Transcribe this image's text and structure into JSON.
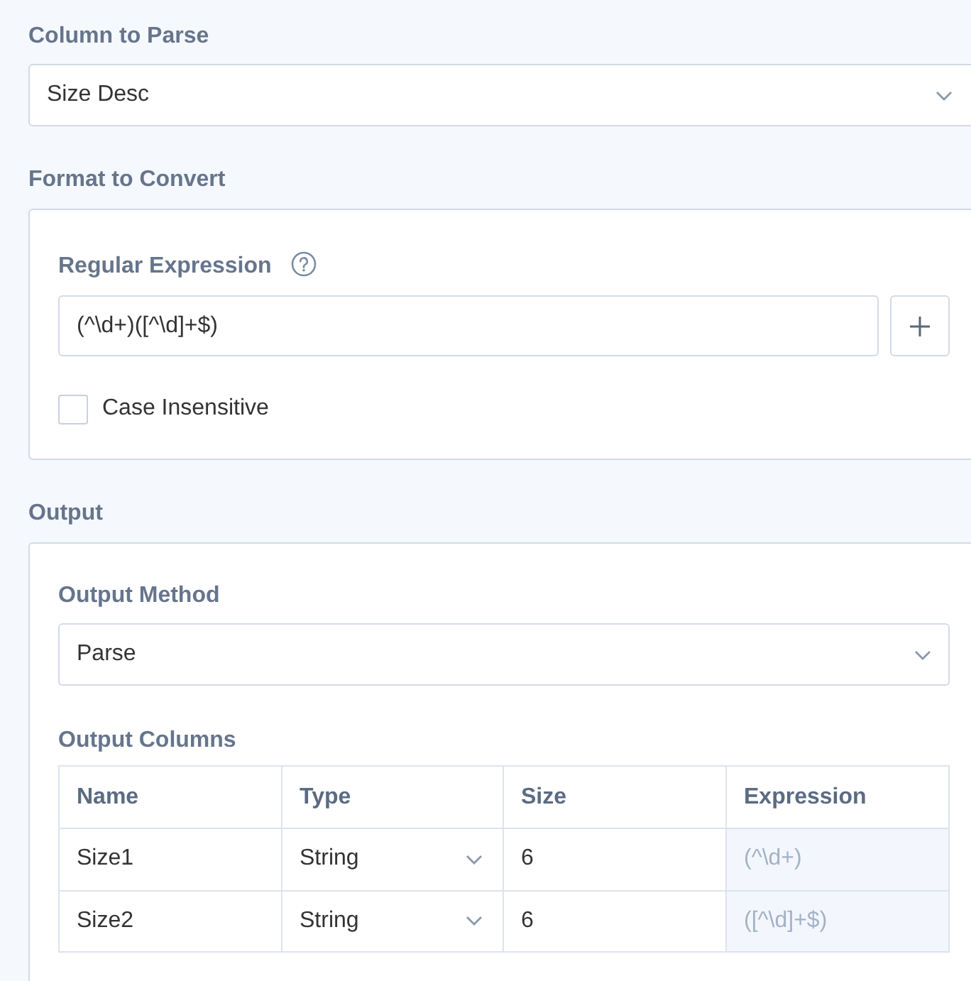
{
  "column_to_parse": {
    "label": "Column to Parse",
    "value": "Size Desc"
  },
  "format_to_convert": {
    "label": "Format to Convert",
    "regular_expression": {
      "label": "Regular Expression",
      "value": "(^\\d+)([^\\d]+$)"
    },
    "case_insensitive": {
      "label": "Case Insensitive",
      "checked": false
    }
  },
  "output": {
    "label": "Output",
    "output_method": {
      "label": "Output Method",
      "value": "Parse"
    },
    "output_columns": {
      "label": "Output Columns",
      "columns": [
        "Name",
        "Type",
        "Size",
        "Expression"
      ],
      "rows": [
        {
          "name": "Size1",
          "type": "String",
          "size": "6",
          "expression": "(^\\d+)"
        },
        {
          "name": "Size2",
          "type": "String",
          "size": "6",
          "expression": "([^\\d]+$)"
        }
      ]
    }
  }
}
